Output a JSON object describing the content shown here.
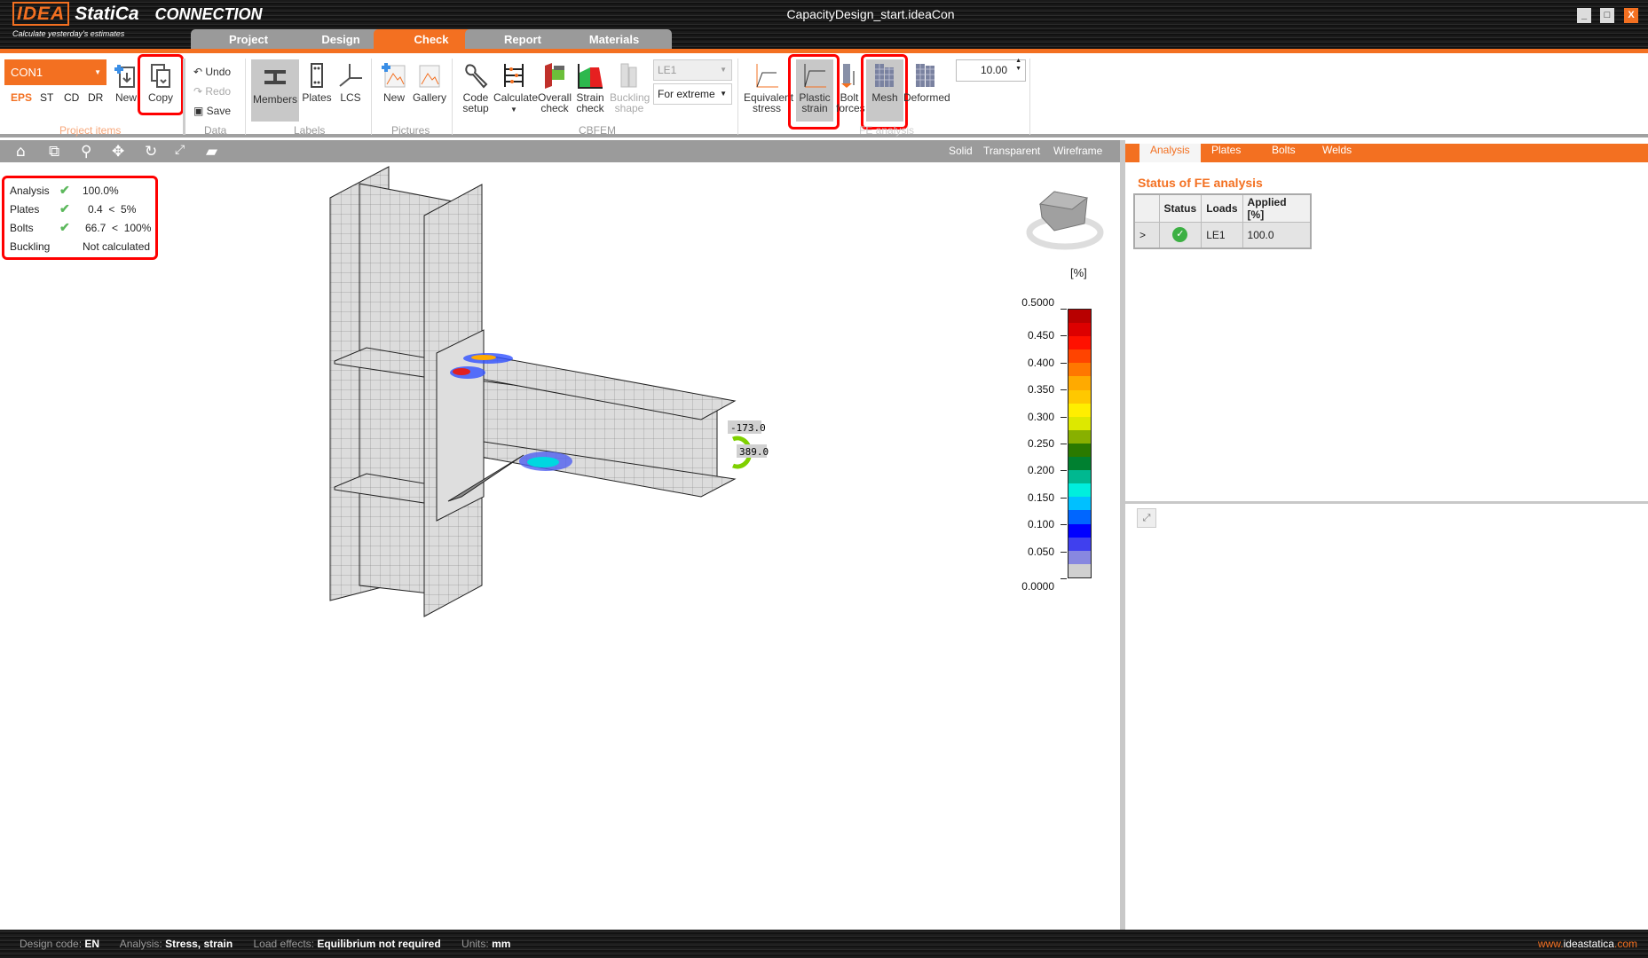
{
  "app": {
    "brand": "IDEA",
    "brand2": "StatiCa",
    "product": "CONNECTION",
    "tagline": "Calculate yesterday's estimates",
    "file_title": "CapacityDesign_start.ideaCon",
    "window_buttons": [
      "_",
      "□",
      "X"
    ]
  },
  "tabs": [
    {
      "label": "Project"
    },
    {
      "label": "Design"
    },
    {
      "label": "Check",
      "active": true
    },
    {
      "label": "Report"
    },
    {
      "label": "Materials"
    }
  ],
  "ribbon": {
    "project_items": {
      "selected": "CON1",
      "modes": [
        "EPS",
        "ST",
        "CD",
        "DR"
      ],
      "active_mode": "EPS",
      "new": "New",
      "copy": "Copy",
      "group": "Project items"
    },
    "data": {
      "undo": "Undo",
      "redo": "Redo",
      "save": "Save",
      "group": "Data"
    },
    "labels": {
      "members": "Members",
      "plates": "Plates",
      "lcs": "LCS",
      "group": "Labels"
    },
    "pictures": {
      "new": "New",
      "gallery": "Gallery",
      "group": "Pictures"
    },
    "cbfem": {
      "code_setup": [
        "Code",
        "setup"
      ],
      "calculate": [
        "Calculate",
        "▼"
      ],
      "overall_check": [
        "Overall",
        "check"
      ],
      "strain_check": [
        "Strain",
        "check"
      ],
      "buckling_shape": [
        "Buckling",
        "shape"
      ],
      "load_case": "LE1",
      "extreme": "For extreme",
      "group": "CBFEM"
    },
    "fe_analysis": {
      "equivalent_stress": [
        "Equivalent",
        "stress"
      ],
      "plastic_strain": [
        "Plastic",
        "strain"
      ],
      "bolt_forces": [
        "Bolt",
        "forces"
      ],
      "mesh": "Mesh",
      "deformed": "Deformed",
      "scale": "10.00",
      "group": "FE analysis"
    }
  },
  "view_toolbar": {
    "icons": [
      "home-icon",
      "zoom-window-icon",
      "zoom-icon",
      "pan-icon",
      "rotate-icon",
      "fit-icon",
      "solid-view-icon"
    ],
    "modes": [
      "Solid",
      "Transparent",
      "Wireframe"
    ]
  },
  "status_box": [
    {
      "label": "Analysis",
      "ok": true,
      "value": "100.0%"
    },
    {
      "label": "Plates",
      "ok": true,
      "value": "0.4  <  5%"
    },
    {
      "label": "Bolts",
      "ok": true,
      "value": "66.7  <  100%"
    },
    {
      "label": "Buckling",
      "ok": false,
      "value": "Not calculated"
    }
  ],
  "model_labels": {
    "force1": "-173.0",
    "force2": "389.0"
  },
  "legend": {
    "unit": "[%]",
    "ticks": [
      "0.5000",
      "0.450",
      "0.400",
      "0.350",
      "0.300",
      "0.250",
      "0.200",
      "0.150",
      "0.100",
      "0.050",
      "0.0000"
    ],
    "colors": [
      "#b80000",
      "#dd0000",
      "#ff1100",
      "#ff4400",
      "#ff7700",
      "#ffaa00",
      "#ffc800",
      "#ffee00",
      "#dde800",
      "#88b000",
      "#2a7a00",
      "#008030",
      "#00b890",
      "#00eedd",
      "#00c0ff",
      "#0066ff",
      "#0000ff",
      "#4040ee",
      "#8888e0",
      "#d0d0d0"
    ]
  },
  "right_panel": {
    "tabs": [
      "Analysis",
      "Plates",
      "Bolts",
      "Welds"
    ],
    "active_tab": "Analysis",
    "title": "Status of FE analysis",
    "table": {
      "headers": [
        "",
        "Status",
        "Loads",
        "Applied [%]"
      ],
      "rows": [
        {
          "expand": ">",
          "status": "ok",
          "load": "LE1",
          "applied": "100.0"
        }
      ]
    }
  },
  "statusbar": {
    "design_code_label": "Design code:",
    "design_code": "EN",
    "analysis_label": "Analysis:",
    "analysis": "Stress, strain",
    "load_effects_label": "Load effects:",
    "load_effects": "Equilibrium not required",
    "units_label": "Units:",
    "units": "mm",
    "web_prefix": "www.",
    "web_mid": "ideastatica",
    "web_suffix": ".com"
  },
  "colors": {
    "accent": "#f37021",
    "highlight": "#ff0000"
  }
}
